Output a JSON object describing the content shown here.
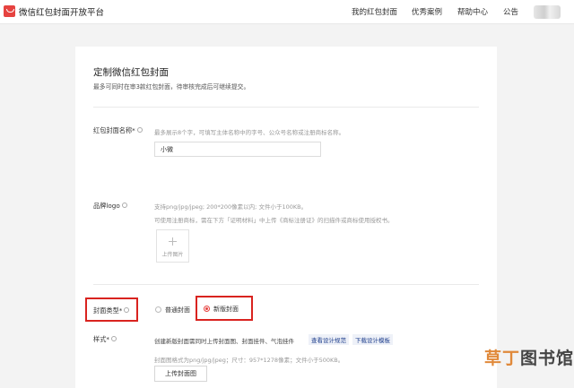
{
  "header": {
    "brand": "微信红包封面开放平台",
    "nav": [
      "我的红包封面",
      "优秀案例",
      "帮助中心",
      "公告"
    ]
  },
  "form": {
    "title": "定制微信红包封面",
    "subtitle": "最多可同时在审3款红包封面，待审核完成后可继续提交。",
    "name_field": {
      "label": "红包封面名称*",
      "hint": "最多展示8个字，可填写主体名称中的字号、公众号名称或注册商标名称。",
      "value": "小微"
    },
    "logo_field": {
      "label": "品牌logo",
      "hint1": "支持png/jpg/jpeg; 200*200像素以内; 文件小于100KB。",
      "hint2": "可使用注册商标，需在下方「证明材料」中上传《商标注册证》的扫描件或商标使用授权书。",
      "upload_label": "上传图片"
    },
    "type_field": {
      "label": "封面类型*",
      "options": [
        "普通封面",
        "新版封面"
      ],
      "selected": "新版封面"
    },
    "style_field": {
      "label": "样式*",
      "desc": "创建新版封面需同时上传封面图、封面挂件、气泡挂件",
      "link1": "查看设计规范",
      "link2": "下载设计模板",
      "format_hint": "封面图格式为png/jpg/jpeg；尺寸：957*1278像素；文件小于500KB。",
      "upload_button": "上传封面图"
    }
  },
  "watermark": {
    "part1": "草丁",
    "part2": "图书馆"
  },
  "colors": {
    "accent": "#e64340",
    "highlight": "#d9231f",
    "link": "#1e3e8c"
  }
}
